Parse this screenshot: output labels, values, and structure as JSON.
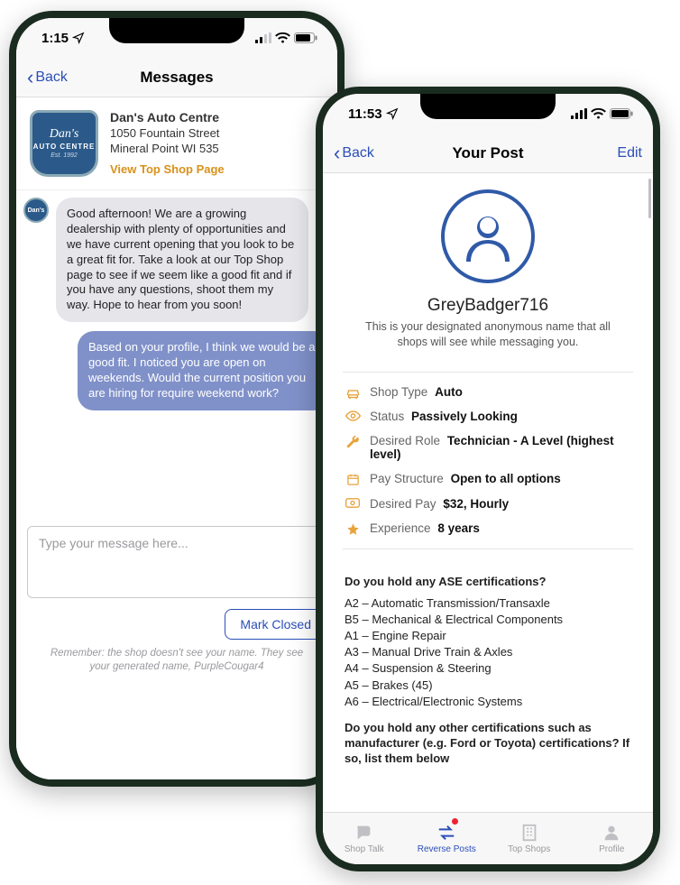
{
  "left_phone": {
    "status": {
      "time": "1:15"
    },
    "nav": {
      "back": "Back",
      "title": "Messages"
    },
    "shop": {
      "name": "Dan's Auto Centre",
      "addr1": "1050 Fountain Street",
      "addr2": "Mineral Point WI 535",
      "link": "View Top Shop Page",
      "badge": {
        "line1": "Dan's",
        "line2": "AUTO CENTRE",
        "line3": "Est. 1992"
      },
      "avatar_short": "Dan's"
    },
    "messages": {
      "incoming": "Good afternoon! We are a growing dealership with plenty of opportunities and we have current opening that you look to be a great fit for. Take a look at our Top Shop page to see if we seem like a good fit and if you have any questions, shoot them my way. Hope to hear from you soon!",
      "outgoing": "Based on your profile, I think we would be a good fit. I noticed you are open on weekends. Would the current position you are hiring for require weekend work?"
    },
    "compose": {
      "placeholder": "Type your message here..."
    },
    "mark_closed": "Mark Closed",
    "footer_note": "Remember: the shop doesn't see your name. They see your generated name, PurpleCougar4"
  },
  "right_phone": {
    "status": {
      "time": "11:53"
    },
    "nav": {
      "back": "Back",
      "title": "Your Post",
      "edit": "Edit"
    },
    "profile": {
      "name": "GreyBadger716",
      "subtitle": "This is your designated anonymous name that all shops will see while messaging you."
    },
    "details": {
      "shop_type": {
        "label": "Shop Type",
        "value": "Auto"
      },
      "status": {
        "label": "Status",
        "value": "Passively Looking"
      },
      "role": {
        "label": "Desired Role",
        "value": "Technician - A Level (highest level)"
      },
      "pay_structure": {
        "label": "Pay Structure",
        "value": "Open to all options"
      },
      "pay": {
        "label": "Desired Pay",
        "value": "$32, Hourly"
      },
      "experience": {
        "label": "Experience",
        "value": "8 years"
      }
    },
    "qa": {
      "q1": "Do you hold any ASE certifications?",
      "a1": [
        "A2 – Automatic Transmission/Transaxle",
        "B5 – Mechanical & Electrical Components",
        "A1 – Engine Repair",
        "A3 – Manual Drive Train & Axles",
        "A4 – Suspension & Steering",
        "A5 – Brakes (45)",
        "A6 – Electrical/Electronic Systems"
      ],
      "q2": "Do you hold any other certifications such as manufacturer (e.g. Ford or Toyota) certifications? If so, list them below"
    },
    "tabs": {
      "shop_talk": "Shop Talk",
      "reverse_posts": "Reverse Posts",
      "top_shops": "Top Shops",
      "profile": "Profile"
    }
  }
}
